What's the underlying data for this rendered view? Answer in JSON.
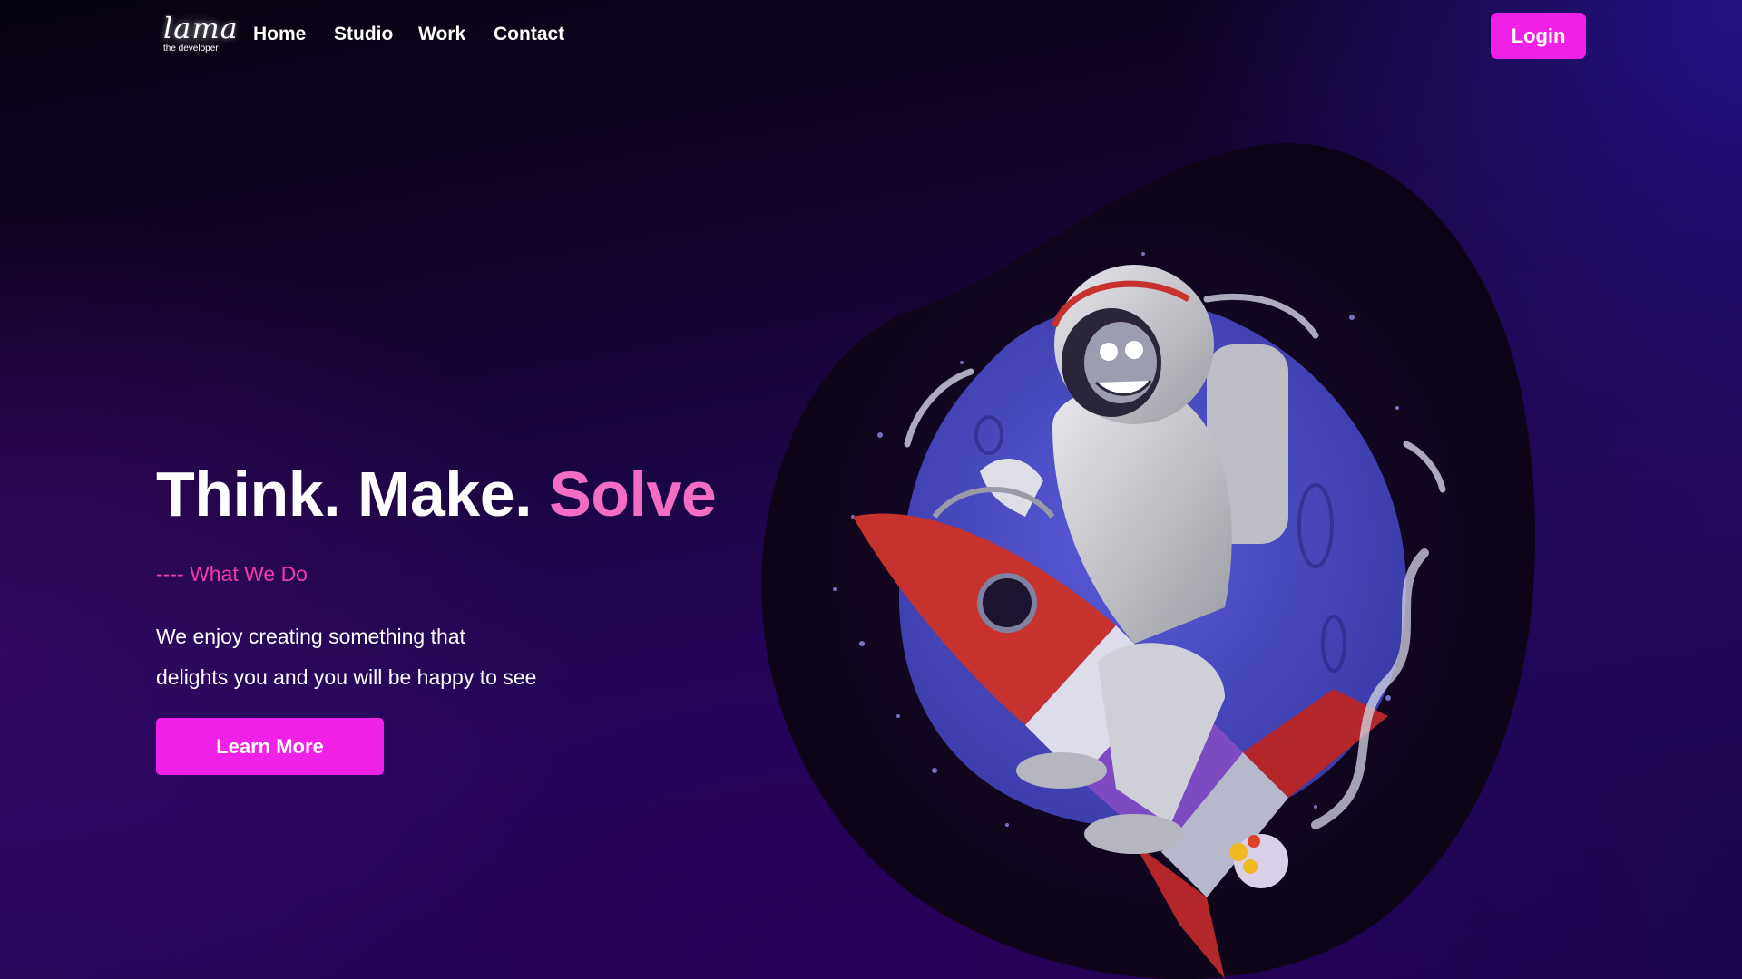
{
  "nav": {
    "logo_text": "lama",
    "logo_subtext": "the developer",
    "links": [
      "Home",
      "Studio",
      "Work",
      "Contact"
    ],
    "login_label": "Login"
  },
  "hero": {
    "title_part1": "Think. Make.",
    "title_accent": "Solve",
    "subtitle": "---- What We Do",
    "description_line1": "We enjoy creating something that",
    "description_line2": "delights you and you will be happy to see",
    "cta_label": "Learn More"
  },
  "colors": {
    "accent": "#f020e6",
    "title_accent": "#f26dc3",
    "subtitle": "#f23aa8",
    "background_dark": "#0a0318",
    "background_purple": "#22075a"
  },
  "illustration": {
    "subject": "astronaut riding a rocket in front of a blue planet"
  }
}
